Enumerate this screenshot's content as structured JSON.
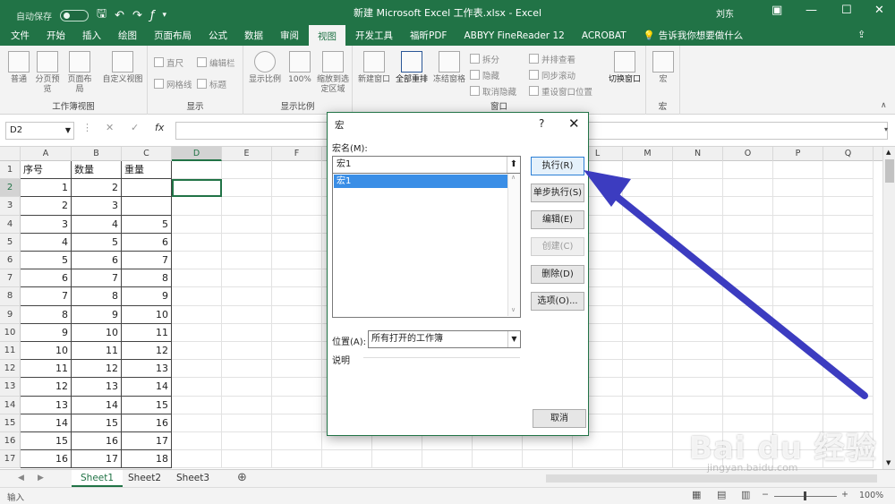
{
  "window": {
    "autosave": "自动保存",
    "title": "新建 Microsoft Excel 工作表.xlsx  -  Excel",
    "user": "刘东"
  },
  "menu": [
    "文件",
    "开始",
    "插入",
    "绘图",
    "页面布局",
    "公式",
    "数据",
    "审阅",
    "视图",
    "开发工具",
    "福昕PDF",
    "ABBYY FineReader 12",
    "ACROBAT"
  ],
  "menu_active": "视图",
  "tell_me": "告诉我你想要做什么",
  "ribbon": {
    "views": {
      "label": "工作簿视图",
      "items": [
        "普通",
        "分页预览",
        "页面布局",
        "自定义视图"
      ]
    },
    "show": {
      "label": "显示",
      "items": [
        "直尺",
        "编辑栏",
        "网格线",
        "标题"
      ]
    },
    "zoom": {
      "label": "显示比例",
      "items": [
        "显示比例",
        "100%",
        "缩放到选定区域"
      ]
    },
    "window": {
      "label": "窗口",
      "big": [
        "新建窗口",
        "全部重排",
        "冻结窗格"
      ],
      "small": [
        "拆分",
        "隐藏",
        "取消隐藏",
        "并排查看",
        "同步滚动",
        "重设窗口位置"
      ],
      "switch": "切换窗口"
    },
    "macros": {
      "label": "宏",
      "items": [
        "宏"
      ]
    }
  },
  "formula_bar": {
    "name_box": "D2",
    "fx": "fx",
    "value": ""
  },
  "grid": {
    "columns": [
      "A",
      "B",
      "C",
      "D",
      "E",
      "F",
      "G",
      "H",
      "I",
      "J",
      "K",
      "L",
      "M",
      "N",
      "O",
      "P",
      "Q"
    ],
    "rows": [
      "1",
      "2",
      "3",
      "4",
      "5",
      "6",
      "7",
      "8",
      "9",
      "10",
      "11",
      "12",
      "13",
      "14",
      "15",
      "16",
      "17"
    ],
    "headers": [
      "序号",
      "数量",
      "重量"
    ],
    "a": [
      "1",
      "2",
      "3",
      "4",
      "5",
      "6",
      "7",
      "8",
      "9",
      "10",
      "11",
      "12",
      "13",
      "14",
      "15",
      "16"
    ],
    "b": [
      "2",
      "3",
      "4",
      "5",
      "6",
      "7",
      "8",
      "9",
      "10",
      "11",
      "12",
      "13",
      "14",
      "15",
      "16",
      "17"
    ],
    "c": [
      "",
      "",
      "5",
      "6",
      "7",
      "8",
      "9",
      "10",
      "11",
      "12",
      "13",
      "14",
      "15",
      "16",
      "17",
      "18"
    ]
  },
  "sheets": [
    "Sheet1",
    "Sheet2",
    "Sheet3"
  ],
  "sheet_active": "Sheet1",
  "status": {
    "mode": "输入",
    "zoom": "100%"
  },
  "dialog": {
    "title": "宏",
    "help": "?",
    "close": "✕",
    "name_label": "宏名(M):",
    "name_value": "宏1",
    "list": [
      "宏1"
    ],
    "buttons": {
      "run": "执行(R)",
      "step": "单步执行(S)",
      "edit": "编辑(E)",
      "create": "创建(C)",
      "delete": "删除(D)",
      "options": "选项(O)...",
      "cancel": "取消"
    },
    "location_label": "位置(A):",
    "location_value": "所有打开的工作簿",
    "description_label": "说明"
  },
  "colors": {
    "excel_green": "#217346",
    "arrow": "#3c3cc0",
    "selection": "#3a8ee6"
  },
  "watermark": {
    "brand": "Bai  du 经验",
    "url": "jingyan.baidu.com"
  }
}
